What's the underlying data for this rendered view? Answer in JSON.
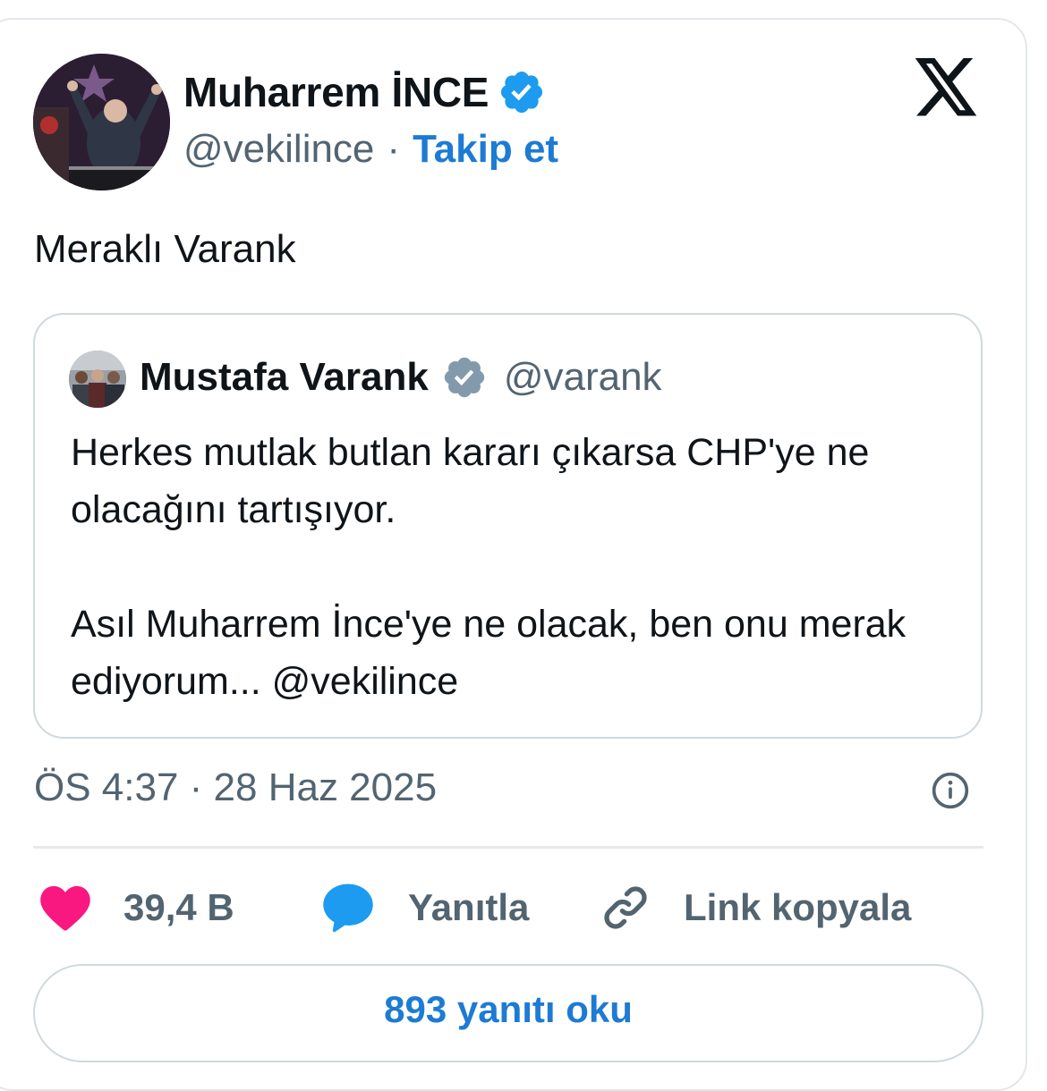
{
  "tweet": {
    "author": {
      "name": "Muharrem İNCE",
      "handle": "@vekilince",
      "separator": "·",
      "follow_label": "Takip et",
      "verified": true
    },
    "text": "Meraklı Varank",
    "quoted": {
      "name": "Mustafa Varank",
      "handle": "@varank",
      "verified_badge": "grey",
      "text": "Herkes mutlak butlan kararı çıkarsa CHP'ye ne olacağını tartışıyor.\n\nAsıl Muharrem İnce'ye ne olacak, ben onu merak ediyorum... @vekilince"
    },
    "timestamp": "ÖS 4:37 · 28 Haz 2025",
    "actions": {
      "like_count": "39,4 B",
      "reply_label": "Yanıtla",
      "copy_link_label": "Link kopyala"
    },
    "read_replies_label": "893 yanıtı oku"
  },
  "icons": {
    "brand": "x-logo-icon",
    "verified": "verified-badge-icon",
    "like": "heart-icon",
    "reply": "speech-bubble-icon",
    "copy": "link-icon",
    "info": "info-icon"
  },
  "colors": {
    "accent": "#1d7bd3",
    "verified_blue": "#1d9bf0",
    "verified_grey": "#829aab",
    "like_pink": "#f91880",
    "reply_blue": "#1d9bf0",
    "text_primary": "#0f1419",
    "text_secondary": "#536471"
  }
}
